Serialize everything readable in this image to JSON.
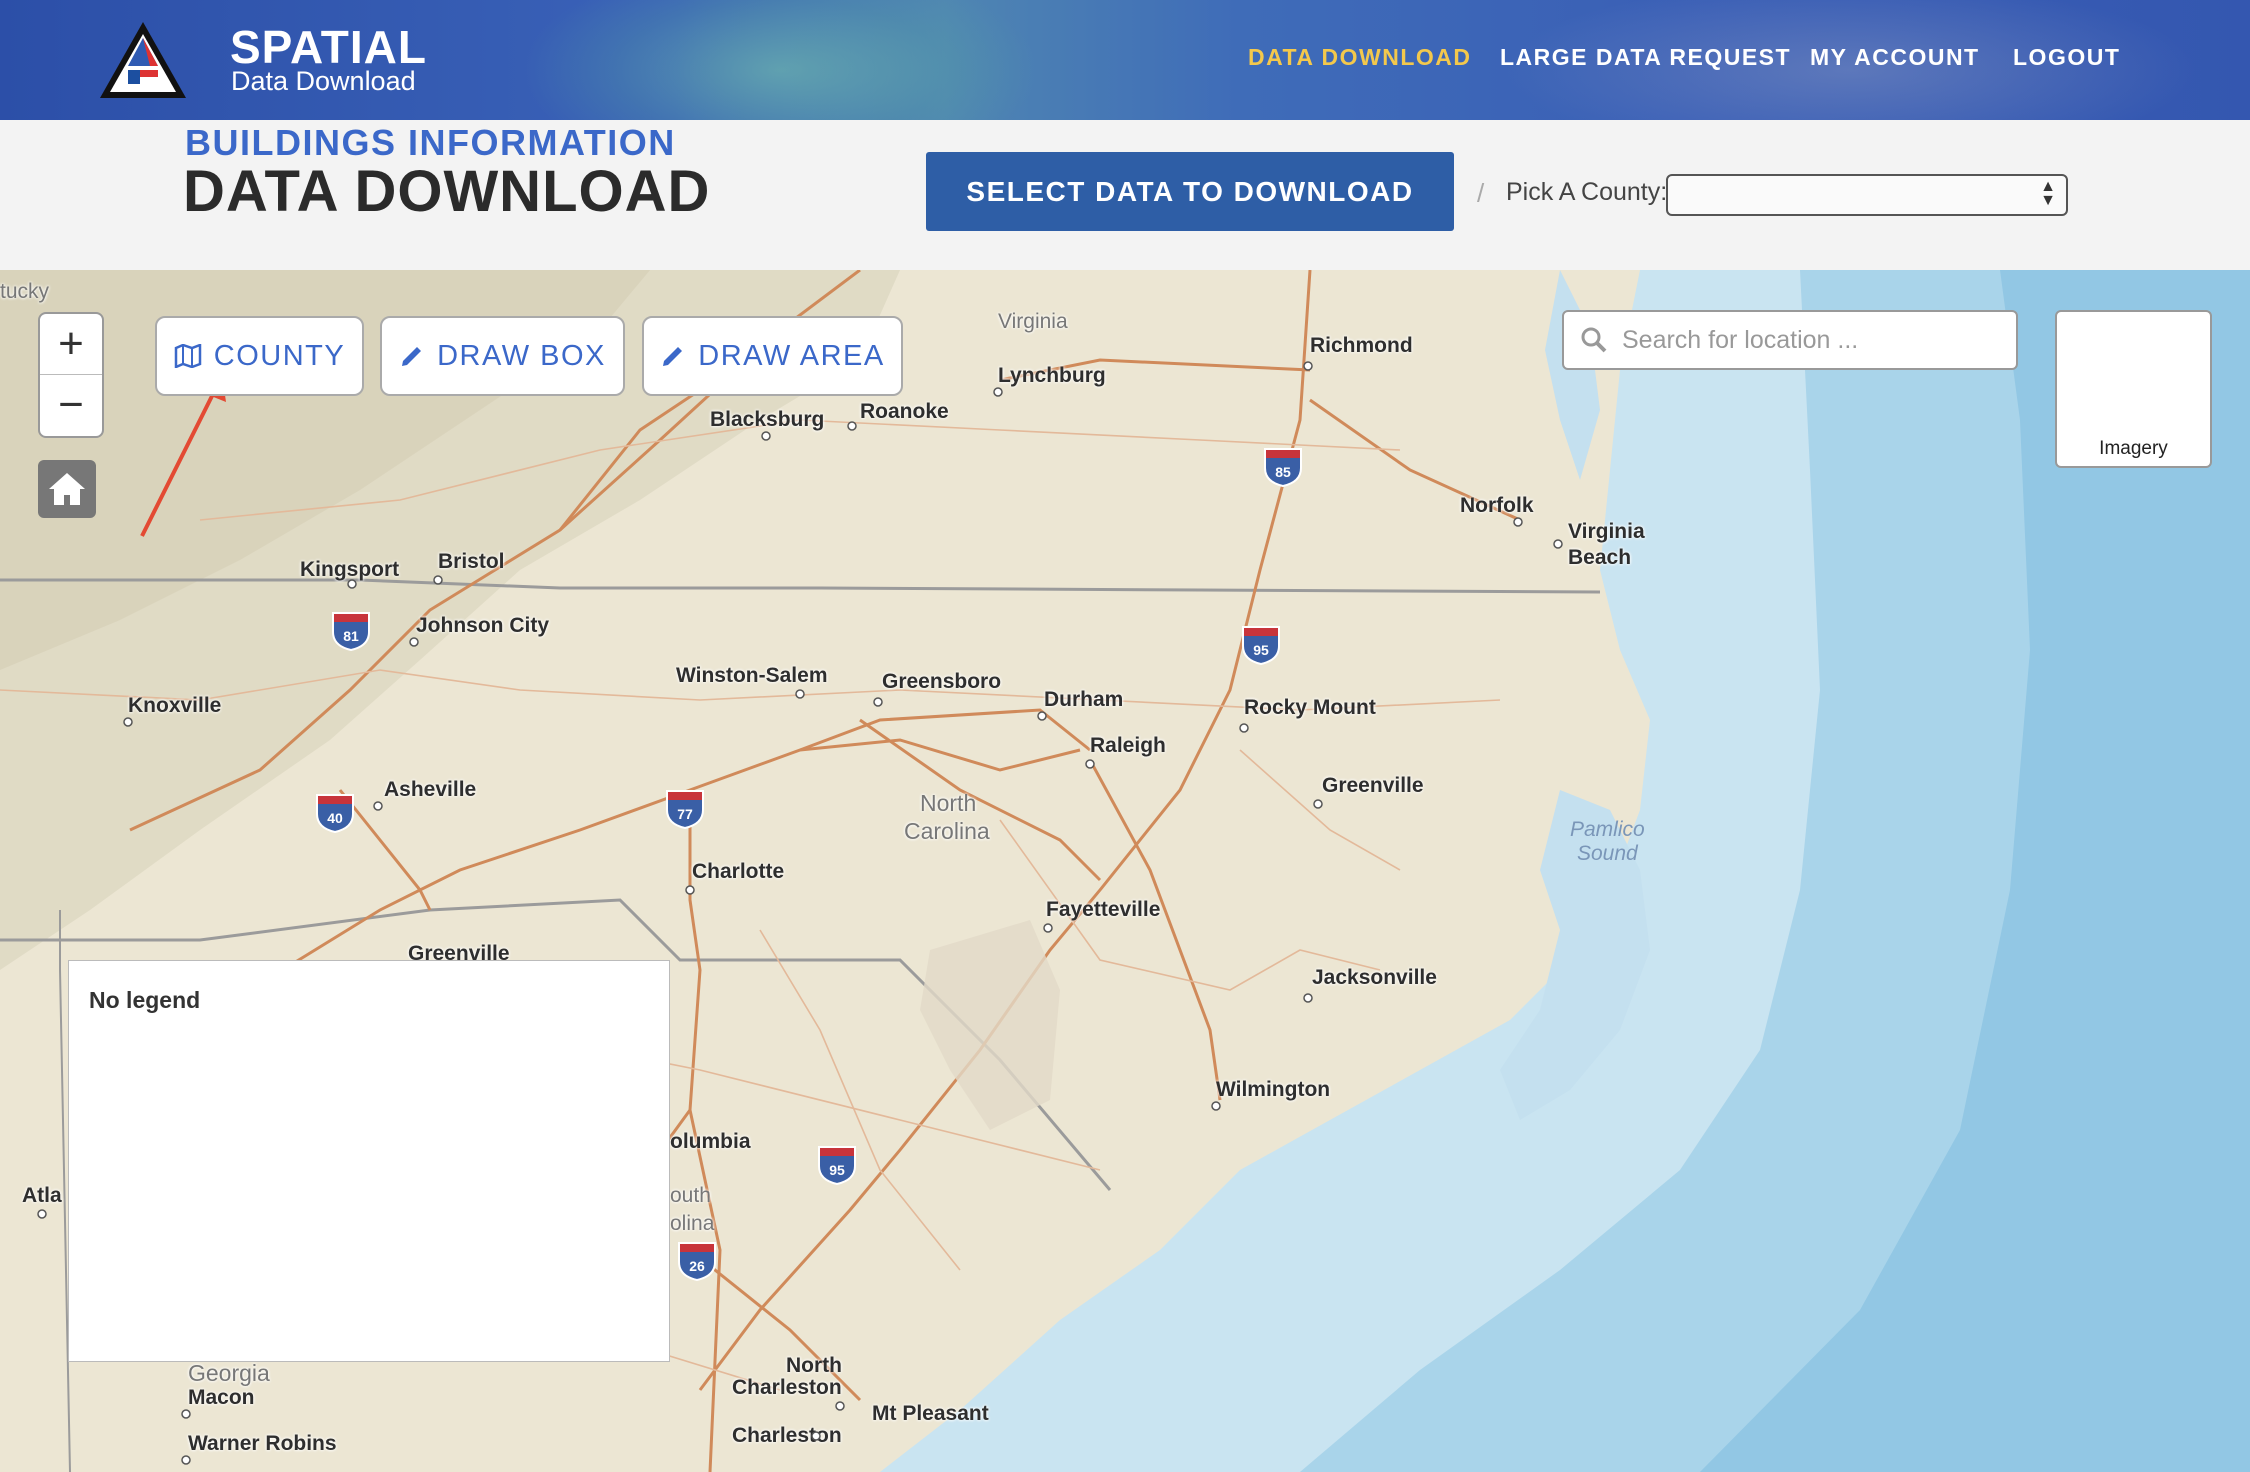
{
  "header": {
    "brand_title": "SPATIAL",
    "brand_subtitle": "Data Download",
    "nav": [
      "DATA DOWNLOAD",
      "LARGE DATA REQUEST",
      "MY ACCOUNT",
      "LOGOUT"
    ],
    "active_nav": "DATA DOWNLOAD",
    "active_color": "#f3c84c"
  },
  "subheader": {
    "kicker": "BUILDINGS INFORMATION",
    "title": "DATA DOWNLOAD",
    "select_button": "SELECT DATA TO DOWNLOAD",
    "separator": "/",
    "county_label": "Pick A County:",
    "county_value": ""
  },
  "map": {
    "tools": [
      "COUNTY",
      "DRAW BOX",
      "DRAW AREA"
    ],
    "zoom_in": "+",
    "zoom_out": "−",
    "search_placeholder": "Search for location ...",
    "basemap_label": "Imagery",
    "legend_text": "No legend",
    "places": [
      "tucky",
      "Virginia",
      "Richmond",
      "Lynchburg",
      "Blacksburg",
      "Roanoke",
      "Norfolk",
      "Virginia",
      "Beach",
      "Kingsport",
      "Bristol",
      "Johnson City",
      "Knoxville",
      "Winston-Salem",
      "Greensboro",
      "Durham",
      "Raleigh",
      "Rocky Mount",
      "Greenville",
      "Asheville",
      "North",
      "Carolina",
      "Charlotte",
      "Fayetteville",
      "Jacksonville",
      "Greenville",
      "Wilmington",
      "olumbia",
      "outh",
      "olina",
      "Atla",
      "Georgia",
      "Macon",
      "Warner Robins",
      "North",
      "Charleston",
      "Charleston",
      "Mt Pleasant"
    ],
    "water_labels": [
      "Pamlico",
      "Sound"
    ],
    "interstates": [
      "85",
      "81",
      "95",
      "77",
      "40",
      "95",
      "26"
    ],
    "colors": {
      "land": "#ece6d3",
      "water": "#bcdcee",
      "ocean": "#8ec6e3",
      "roads": "#d08a5a",
      "brand_blue": "#3b68c9",
      "button_blue": "#2e5ea6"
    }
  }
}
